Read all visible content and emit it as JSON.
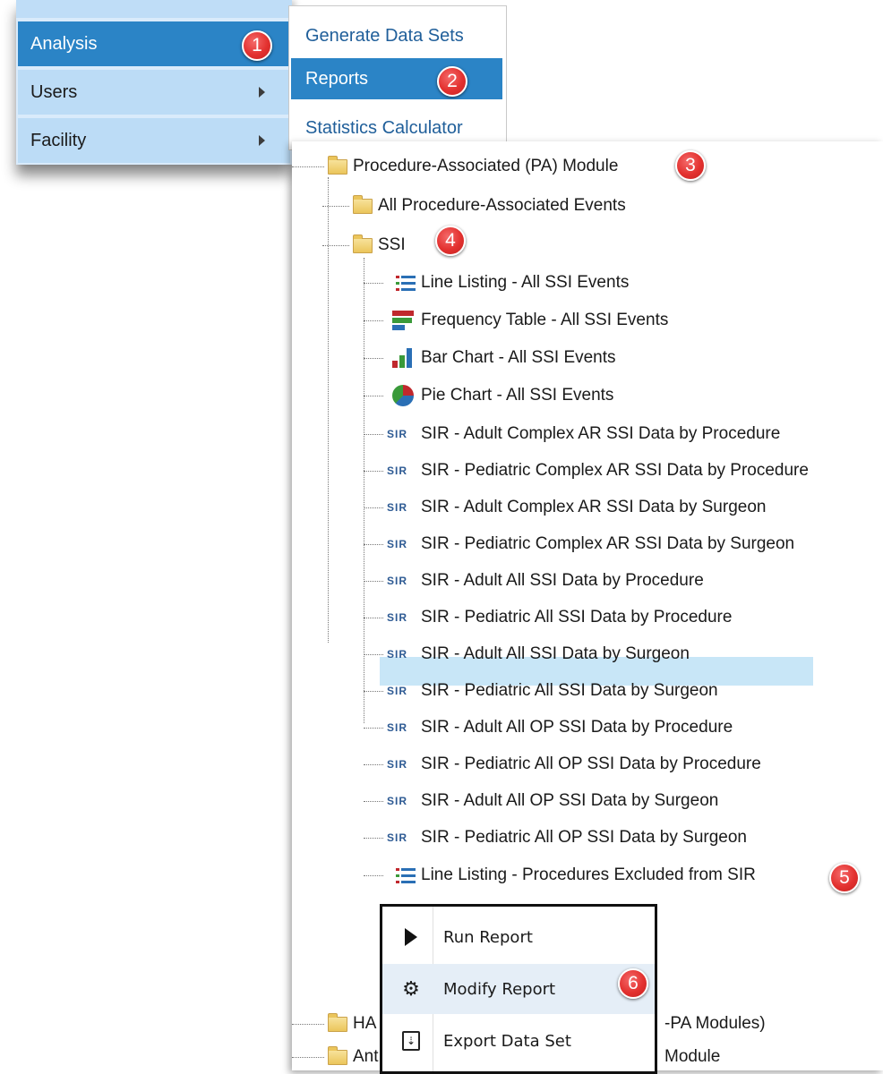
{
  "main_menu": {
    "items": [
      {
        "label": "Analysis",
        "active": true
      },
      {
        "label": "Users",
        "active": false
      },
      {
        "label": "Facility",
        "active": false
      }
    ]
  },
  "sub_menu": {
    "items": [
      {
        "label": "Generate Data Sets"
      },
      {
        "label": "Reports",
        "active": true
      },
      {
        "label": "Statistics Calculator"
      }
    ]
  },
  "badges": [
    "1",
    "2",
    "3",
    "4",
    "5",
    "6"
  ],
  "tree": {
    "module": "Procedure-Associated (PA) Module",
    "all_events": "All Procedure-Associated Events",
    "ssi_folder": "SSI",
    "reports": [
      {
        "icon": "line-listing-icon",
        "label": "Line Listing - All SSI Events"
      },
      {
        "icon": "frequency-table-icon",
        "label": "Frequency Table - All SSI Events"
      },
      {
        "icon": "bar-chart-icon",
        "label": "Bar Chart - All SSI Events"
      },
      {
        "icon": "pie-chart-icon",
        "label": "Pie Chart - All SSI Events"
      },
      {
        "icon": "sir-icon",
        "label": "SIR - Adult Complex AR SSI Data by Procedure"
      },
      {
        "icon": "sir-icon",
        "label": "SIR - Pediatric Complex AR SSI Data by Procedure"
      },
      {
        "icon": "sir-icon",
        "label": "SIR - Adult Complex AR SSI Data by Surgeon"
      },
      {
        "icon": "sir-icon",
        "label": "SIR - Pediatric Complex AR SSI Data by Surgeon"
      },
      {
        "icon": "sir-icon",
        "label": "SIR - Adult All SSI Data by Procedure"
      },
      {
        "icon": "sir-icon",
        "label": "SIR - Pediatric All SSI Data by Procedure"
      },
      {
        "icon": "sir-icon",
        "label": "SIR - Adult All SSI Data by Surgeon"
      },
      {
        "icon": "sir-icon",
        "label": "SIR - Pediatric All SSI Data by Surgeon"
      },
      {
        "icon": "sir-icon",
        "label": "SIR - Adult All OP SSI Data by Procedure"
      },
      {
        "icon": "sir-icon",
        "label": "SIR - Pediatric All OP SSI Data by Procedure"
      },
      {
        "icon": "sir-icon",
        "label": "SIR - Adult All OP SSI Data by Surgeon"
      },
      {
        "icon": "sir-icon",
        "label": "SIR - Pediatric All OP SSI Data by Surgeon"
      },
      {
        "icon": "line-listing-icon",
        "label": "Line Listing - Procedures Excluded from SIR",
        "selected": true
      }
    ],
    "sir_icon_text": "SIR",
    "partial_rows": [
      {
        "left": "HA",
        "right": "-PA Modules)"
      },
      {
        "left": "Ant",
        "right": "Module"
      }
    ]
  },
  "context_menu": {
    "items": [
      {
        "icon": "play-icon",
        "label": "Run Report"
      },
      {
        "icon": "gear-icon",
        "label": "Modify Report",
        "hover": true
      },
      {
        "icon": "export-icon",
        "label": "Export Data Set"
      }
    ]
  }
}
